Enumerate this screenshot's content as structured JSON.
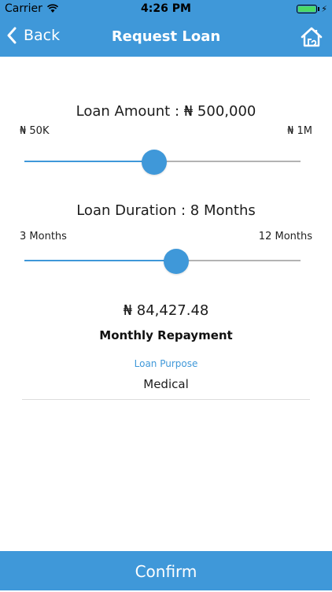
{
  "status_bar": {
    "carrier": "Carrier",
    "time": "4:26 PM",
    "battery_icon": "battery-icon",
    "battery_color": "#4cd964"
  },
  "nav": {
    "back_label": "Back",
    "title": "Request Loan",
    "home_icon": "home-icon"
  },
  "loan_amount": {
    "title": "Loan Amount : ₦ 500,000",
    "min_label": "₦ 50K",
    "max_label": "₦ 1M",
    "slider_position": 0.47
  },
  "loan_duration": {
    "title": "Loan Duration : 8 Months",
    "min_label": "3 Months",
    "max_label": "12 Months",
    "slider_position": 0.55
  },
  "repayment": {
    "amount": "₦ 84,427.48",
    "label": "Monthly Repayment"
  },
  "purpose": {
    "label": "Loan Purpose",
    "value": "Medical"
  },
  "confirm_label": "Confirm",
  "colors": {
    "accent": "#3f98d9",
    "track": "#b3b3b3"
  }
}
